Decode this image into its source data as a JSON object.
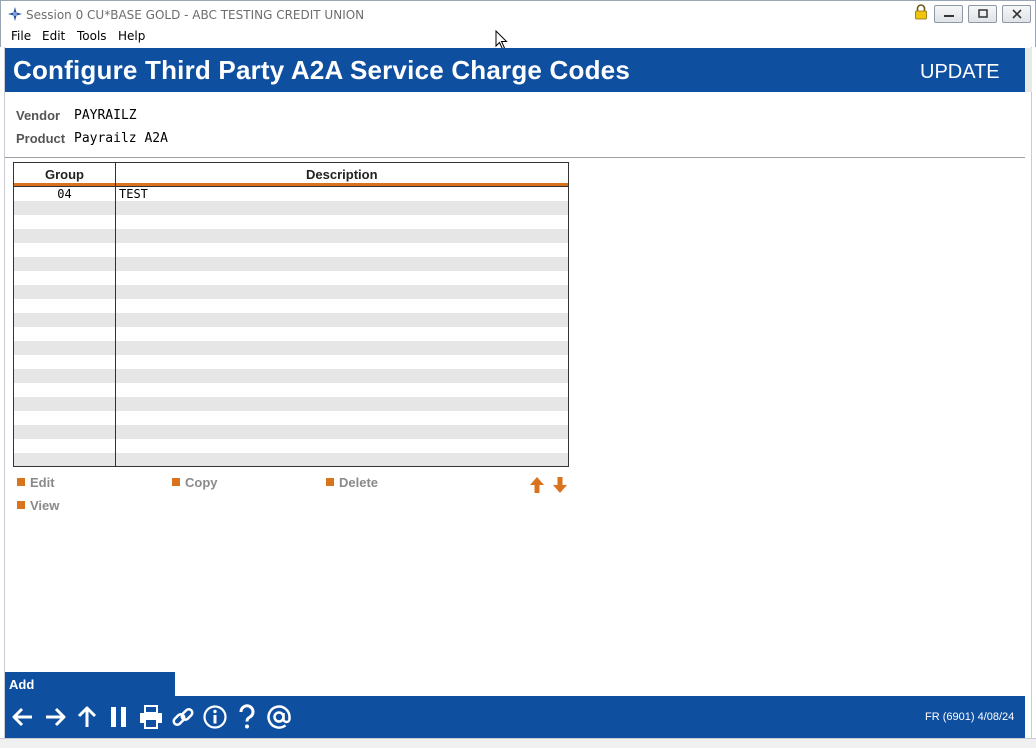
{
  "window": {
    "title": "Session 0 CU*BASE GOLD - ABC TESTING CREDIT UNION"
  },
  "menu": [
    "File",
    "Edit",
    "Tools",
    "Help"
  ],
  "header": {
    "title": "Configure Third Party A2A Service Charge Codes",
    "mode": "UPDATE"
  },
  "fields": {
    "vendor_label": "Vendor",
    "vendor_value": "PAYRAILZ",
    "product_label": "Product",
    "product_value": "Payrailz A2A"
  },
  "grid": {
    "columns": [
      "Group",
      "Description"
    ],
    "rows": [
      {
        "group": "04",
        "description": "TEST"
      }
    ],
    "visible_row_count": 20
  },
  "actions": [
    "Edit",
    "Copy",
    "Delete",
    "View"
  ],
  "add_label": "Add",
  "footer": {
    "icons": [
      "back-icon",
      "forward-icon",
      "up-icon",
      "pause-icon",
      "print-icon",
      "link-icon",
      "info-icon",
      "help-icon",
      "email-icon"
    ],
    "status": "FR (6901) 4/08/24"
  },
  "colors": {
    "brand_blue": "#0f4fa0",
    "accent_orange": "#d9731c"
  }
}
